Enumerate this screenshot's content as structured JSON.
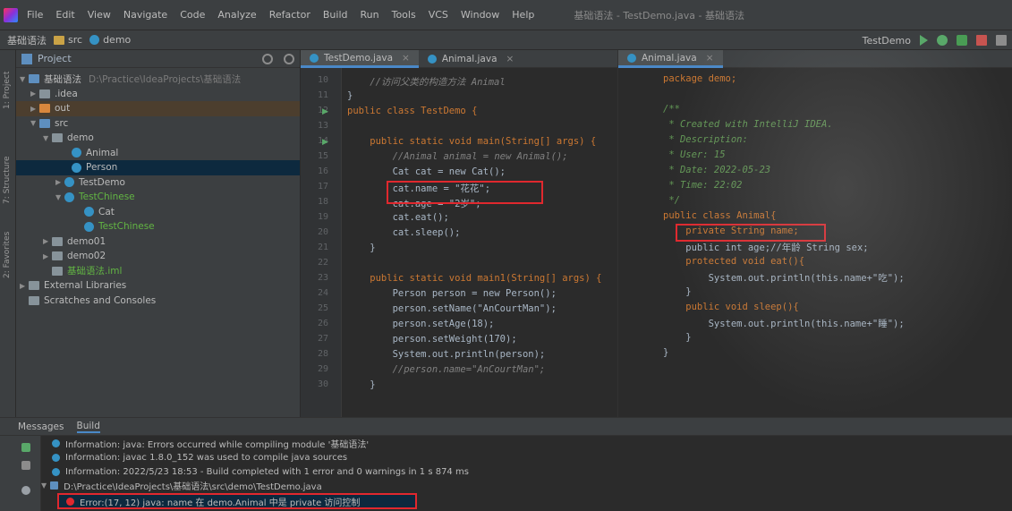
{
  "menubar": {
    "items": [
      "File",
      "Edit",
      "View",
      "Navigate",
      "Code",
      "Analyze",
      "Refactor",
      "Build",
      "Run",
      "Tools",
      "VCS",
      "Window",
      "Help"
    ],
    "title": "基础语法 - TestDemo.java - 基础语法"
  },
  "toolbar": {
    "crumbs": [
      "基础语法",
      "src",
      "demo"
    ],
    "run_config": "TestDemo"
  },
  "sidestrip": {
    "labels": [
      "1: Project",
      "7: Structure",
      "2: Favorites"
    ]
  },
  "project": {
    "header_label": "Project",
    "tree": [
      {
        "label": "基础语法",
        "hint": "D:\\Practice\\IdeaProjects\\基础语法"
      },
      {
        "label": ".idea"
      },
      {
        "label": "out"
      },
      {
        "label": "src"
      },
      {
        "label": "demo"
      },
      {
        "label": "Animal"
      },
      {
        "label": "Person"
      },
      {
        "label": "TestDemo"
      },
      {
        "label": "TestChinese"
      },
      {
        "label": "Cat"
      },
      {
        "label": "TestChinese"
      },
      {
        "label": "demo01"
      },
      {
        "label": "demo02"
      },
      {
        "label": "基础语法.iml"
      },
      {
        "label": "External Libraries"
      },
      {
        "label": "Scratches and Consoles"
      }
    ]
  },
  "editor_left": {
    "tabs": [
      {
        "label": "TestDemo.java"
      },
      {
        "label": "Animal.java"
      }
    ],
    "lines": [
      {
        "num": "10",
        "text": "    //访问父类的构造方法 Animal"
      },
      {
        "num": "11",
        "text": "}"
      },
      {
        "num": "12",
        "text": "public class TestDemo {"
      },
      {
        "num": "13",
        "text": ""
      },
      {
        "num": "14",
        "text": "    public static void main(String[] args) {"
      },
      {
        "num": "15",
        "text": "        //Animal animal = new Animal();"
      },
      {
        "num": "16",
        "text": "        Cat cat = new Cat();"
      },
      {
        "num": "17",
        "text": "        cat.name = \"花花\";"
      },
      {
        "num": "18",
        "text": "        cat.age = \"2岁\";"
      },
      {
        "num": "19",
        "text": "        cat.eat();"
      },
      {
        "num": "20",
        "text": "        cat.sleep();"
      },
      {
        "num": "21",
        "text": "    }"
      },
      {
        "num": "22",
        "text": ""
      },
      {
        "num": "23",
        "text": "    public static void main1(String[] args) {"
      },
      {
        "num": "24",
        "text": "        Person person = new Person();"
      },
      {
        "num": "25",
        "text": "        person.setName(\"AnCourtMan\");"
      },
      {
        "num": "26",
        "text": "        person.setAge(18);"
      },
      {
        "num": "27",
        "text": "        person.setWeight(170);"
      },
      {
        "num": "28",
        "text": "        System.out.println(person);"
      },
      {
        "num": "29",
        "text": "        //person.name=\"AnCourtMan\";"
      },
      {
        "num": "30",
        "text": "    }"
      }
    ]
  },
  "editor_right": {
    "tabs": [
      {
        "label": "Animal.java"
      }
    ],
    "lines": [
      {
        "text": "package demo;"
      },
      {
        "text": ""
      },
      {
        "text": "/**"
      },
      {
        "text": " * Created with IntelliJ IDEA."
      },
      {
        "text": " * Description:"
      },
      {
        "text": " * User: 15"
      },
      {
        "text": " * Date: 2022-05-23"
      },
      {
        "text": " * Time: 22:02"
      },
      {
        "text": " */"
      },
      {
        "text": "public class Animal{"
      },
      {
        "text": "    private String name;"
      },
      {
        "text": "    public int age;//年龄 String sex;"
      },
      {
        "text": "    protected void eat(){"
      },
      {
        "text": "        System.out.println(this.name+\"吃\");"
      },
      {
        "text": "    }"
      },
      {
        "text": "    public void sleep(){"
      },
      {
        "text": "        System.out.println(this.name+\"睡\");"
      },
      {
        "text": "    }"
      },
      {
        "text": "}"
      }
    ]
  },
  "bottom": {
    "tabs": [
      "Messages",
      "Build"
    ],
    "messages": [
      {
        "text": "Information: java: Errors occurred while compiling module '基础语法'",
        "type": "info"
      },
      {
        "text": "Information: javac 1.8.0_152 was used to compile java sources",
        "type": "info"
      },
      {
        "text": "Information: 2022/5/23 18:53 - Build completed with 1 error and 0 warnings in 1 s 874 ms",
        "type": "info"
      },
      {
        "text": "D:\\Practice\\IdeaProjects\\基础语法\\src\\demo\\TestDemo.java",
        "type": "info"
      },
      {
        "text": "Error:(17, 12) java: name 在 demo.Animal 中是 private 访问控制",
        "type": "error"
      }
    ]
  },
  "colors": {
    "highlight_box": "#e0282e",
    "accent": "#4a88c7",
    "keyword": "#cc7832",
    "string": "#6a8759"
  }
}
